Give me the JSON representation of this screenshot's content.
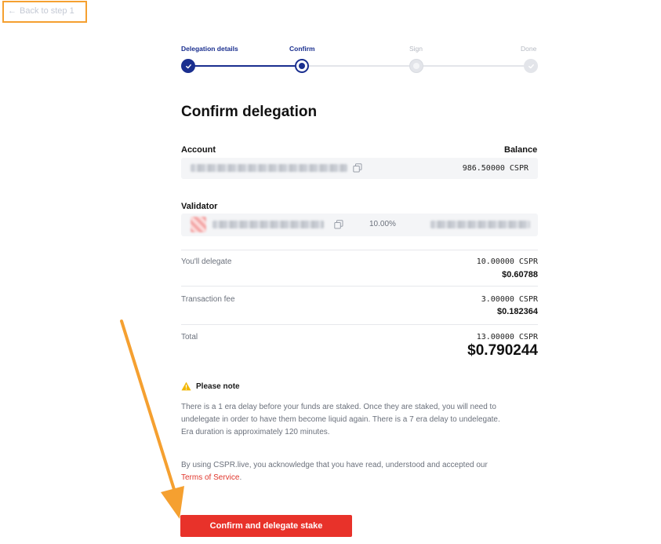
{
  "back_link": {
    "label": "Back to step 1"
  },
  "stepper": {
    "steps": [
      {
        "label": "Delegation details",
        "state": "done"
      },
      {
        "label": "Confirm",
        "state": "active"
      },
      {
        "label": "Sign",
        "state": "future"
      },
      {
        "label": "Done",
        "state": "future"
      }
    ]
  },
  "page_title": "Confirm delegation",
  "account": {
    "header_label": "Account",
    "balance_header": "Balance",
    "balance_value": "986.50000 CSPR"
  },
  "validator": {
    "header_label": "Validator",
    "commission": "10.00%"
  },
  "summary": {
    "delegate": {
      "label": "You'll delegate",
      "cspr": "10.00000 CSPR",
      "usd": "$0.60788"
    },
    "fee": {
      "label": "Transaction fee",
      "cspr": "3.00000 CSPR",
      "usd": "$0.182364"
    },
    "total": {
      "label": "Total",
      "cspr": "13.00000 CSPR",
      "usd": "$0.790244"
    }
  },
  "note": {
    "title": "Please note",
    "text_line1": "There is a 1 era delay before your funds are staked. Once they are staked, you will need to",
    "text_line2": "undelegate in order to have them become liquid again. There is a 7 era delay to undelegate.",
    "text_line3": "Era duration is approximately 120 minutes."
  },
  "terms": {
    "text": "By using CSPR.live, you acknowledge that you have read, understood and accepted our",
    "link_label": "Terms of Service",
    "suffix": "."
  },
  "confirm_button": {
    "label": "Confirm and delegate stake"
  },
  "colors": {
    "brand_blue": "#1a2f8f",
    "accent_red": "#e8322a",
    "annotation_orange": "#f5a030"
  }
}
